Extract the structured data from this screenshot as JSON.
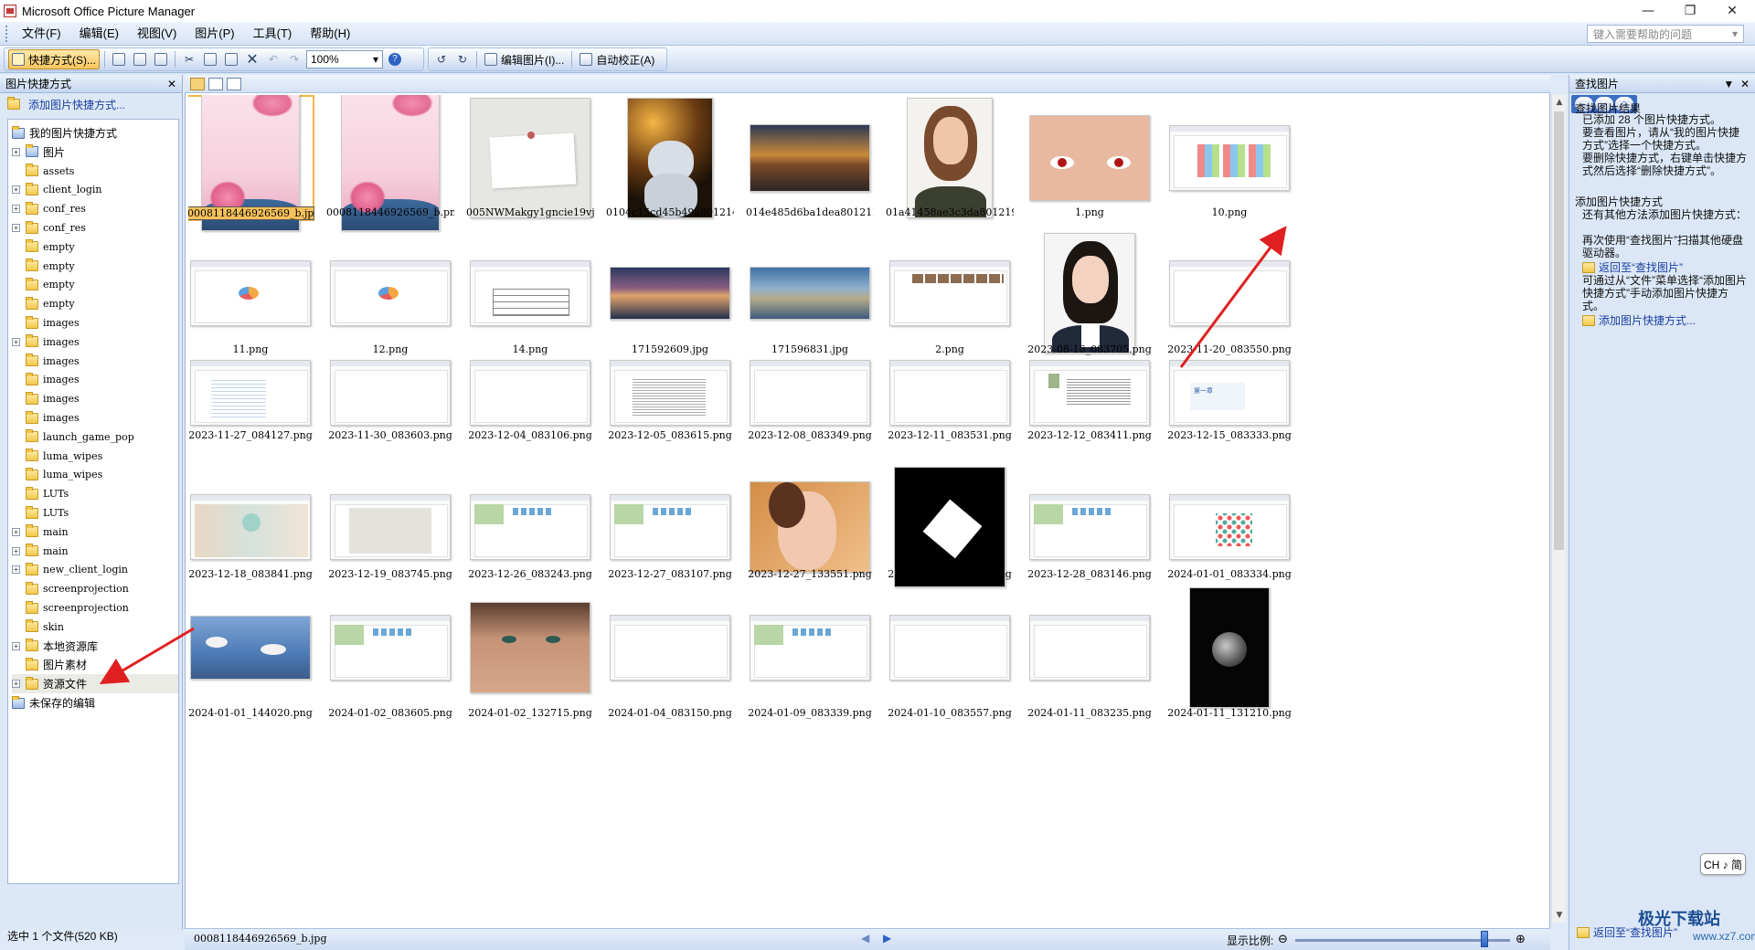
{
  "window": {
    "title": "Microsoft Office Picture Manager",
    "minimize": "—",
    "maximize": "❐",
    "close": "✕"
  },
  "menu": [
    "文件(F)",
    "编辑(E)",
    "视图(V)",
    "图片(P)",
    "工具(T)",
    "帮助(H)"
  ],
  "help_search_placeholder": "键入需要帮助的问题",
  "toolbar": {
    "shortcuts_label": "快捷方式(S)...",
    "zoom": "100%",
    "edit_picture_label": "编辑图片(I)...",
    "auto_correct_label": "自动校正(A)"
  },
  "left_pane": {
    "title": "图片快捷方式",
    "add_shortcut": "添加图片快捷方式...",
    "tree": [
      {
        "label": "我的图片快捷方式",
        "level": 0,
        "expander": "",
        "icon": "shortcut-root-icon"
      },
      {
        "label": "图片",
        "level": 1,
        "expander": "+",
        "icon": "picture-folder-icon"
      },
      {
        "label": "assets",
        "level": 1,
        "expander": "",
        "icon": "folder-icon",
        "mono": true
      },
      {
        "label": "client_login",
        "level": 1,
        "expander": "+",
        "icon": "folder-icon",
        "mono": true
      },
      {
        "label": "conf_res",
        "level": 1,
        "expander": "+",
        "icon": "folder-icon",
        "mono": true
      },
      {
        "label": "conf_res",
        "level": 1,
        "expander": "+",
        "icon": "folder-icon",
        "mono": true
      },
      {
        "label": "empty",
        "level": 1,
        "expander": "",
        "icon": "folder-icon",
        "mono": true
      },
      {
        "label": "empty",
        "level": 1,
        "expander": "",
        "icon": "folder-icon",
        "mono": true
      },
      {
        "label": "empty",
        "level": 1,
        "expander": "",
        "icon": "folder-icon",
        "mono": true
      },
      {
        "label": "empty",
        "level": 1,
        "expander": "",
        "icon": "folder-icon",
        "mono": true
      },
      {
        "label": "images",
        "level": 1,
        "expander": "",
        "icon": "folder-icon",
        "mono": true
      },
      {
        "label": "images",
        "level": 1,
        "expander": "+",
        "icon": "folder-icon",
        "mono": true
      },
      {
        "label": "images",
        "level": 1,
        "expander": "",
        "icon": "folder-icon",
        "mono": true
      },
      {
        "label": "images",
        "level": 1,
        "expander": "",
        "icon": "folder-icon",
        "mono": true
      },
      {
        "label": "images",
        "level": 1,
        "expander": "",
        "icon": "folder-icon",
        "mono": true
      },
      {
        "label": "images",
        "level": 1,
        "expander": "",
        "icon": "folder-icon",
        "mono": true
      },
      {
        "label": "launch_game_pop",
        "level": 1,
        "expander": "",
        "icon": "folder-icon",
        "mono": true
      },
      {
        "label": "luma_wipes",
        "level": 1,
        "expander": "",
        "icon": "folder-icon",
        "mono": true
      },
      {
        "label": "luma_wipes",
        "level": 1,
        "expander": "",
        "icon": "folder-icon",
        "mono": true
      },
      {
        "label": "LUTs",
        "level": 1,
        "expander": "",
        "icon": "folder-icon",
        "mono": true
      },
      {
        "label": "LUTs",
        "level": 1,
        "expander": "",
        "icon": "folder-icon",
        "mono": true
      },
      {
        "label": "main",
        "level": 1,
        "expander": "+",
        "icon": "folder-icon",
        "mono": true
      },
      {
        "label": "main",
        "level": 1,
        "expander": "+",
        "icon": "folder-icon",
        "mono": true
      },
      {
        "label": "new_client_login",
        "level": 1,
        "expander": "+",
        "icon": "folder-icon",
        "mono": true
      },
      {
        "label": "screenprojection",
        "level": 1,
        "expander": "",
        "icon": "folder-icon",
        "mono": true
      },
      {
        "label": "screenprojection",
        "level": 1,
        "expander": "",
        "icon": "folder-icon",
        "mono": true
      },
      {
        "label": "skin",
        "level": 1,
        "expander": "",
        "icon": "folder-icon",
        "mono": true
      },
      {
        "label": "本地资源库",
        "level": 1,
        "expander": "+",
        "icon": "folder-icon"
      },
      {
        "label": "图片素材",
        "level": 1,
        "expander": "",
        "icon": "folder-icon"
      },
      {
        "label": "资源文件",
        "level": 1,
        "expander": "+",
        "icon": "folder-icon",
        "selected": true
      },
      {
        "label": "未保存的编辑",
        "level": 0,
        "expander": "",
        "icon": "unsaved-edits-icon"
      }
    ],
    "status": "选中 1 个文件(520 KB)"
  },
  "grid": {
    "rows": [
      [
        {
          "name": "0008118446926569_b.jpg",
          "kind": "pink-flowers",
          "selected": true
        },
        {
          "name": "0008118446926569_b.png",
          "kind": "pink-flowers"
        },
        {
          "name": "005NWMakgy1gncie19vj0j30j...",
          "kind": "card"
        },
        {
          "name": "0104c15cd45b49a8012141681...",
          "kind": "cat"
        },
        {
          "name": "014e485d6ba1dea801211f9e3...",
          "kind": "sunset"
        },
        {
          "name": "01a41458ae3c3da801219c774...",
          "kind": "portrait-woman"
        },
        {
          "name": "1.png",
          "kind": "eyes"
        },
        {
          "name": "10.png",
          "kind": "screenshot-colorful"
        }
      ],
      [
        {
          "name": "11.png",
          "kind": "screenshot-pie"
        },
        {
          "name": "12.png",
          "kind": "screenshot-pie"
        },
        {
          "name": "14.png",
          "kind": "screenshot-table"
        },
        {
          "name": "171592609.jpg",
          "kind": "city-night"
        },
        {
          "name": "171596831.jpg",
          "kind": "city-day"
        },
        {
          "name": "2.png",
          "kind": "screenshot-app"
        },
        {
          "name": "2023-08-16_083705.png",
          "kind": "portrait-girl"
        },
        {
          "name": "2023-11-20_083550.png",
          "kind": "screenshot"
        }
      ],
      [
        {
          "name": "2023-11-27_084127.png",
          "kind": "screenshot-list"
        },
        {
          "name": "2023-11-30_083603.png",
          "kind": "screenshot"
        },
        {
          "name": "2023-12-04_083106.png",
          "kind": "screenshot"
        },
        {
          "name": "2023-12-05_083615.png",
          "kind": "screenshot-text"
        },
        {
          "name": "2023-12-08_083349.png",
          "kind": "screenshot"
        },
        {
          "name": "2023-12-11_083531.png",
          "kind": "screenshot"
        },
        {
          "name": "2023-12-12_083411.png",
          "kind": "screenshot-doc"
        },
        {
          "name": "2023-12-15_083333.png",
          "kind": "screenshot-slide",
          "slide_text": "第一章"
        }
      ],
      [
        {
          "name": "2023-12-18_083841.png",
          "kind": "screenshot-blur"
        },
        {
          "name": "2023-12-19_083745.png",
          "kind": "screenshot-gray"
        },
        {
          "name": "2023-12-26_083243.png",
          "kind": "screenshot-sheet"
        },
        {
          "name": "2023-12-27_083107.png",
          "kind": "screenshot-sheet"
        },
        {
          "name": "2023-12-27_133551.png",
          "kind": "smiling-woman"
        },
        {
          "name": "2023-12-27_134728.png",
          "kind": "black-diamond"
        },
        {
          "name": "2023-12-28_083146.png",
          "kind": "screenshot-sheet"
        },
        {
          "name": "2024-01-01_083334.png",
          "kind": "screenshot-dots"
        }
      ],
      [
        {
          "name": "2024-01-01_144020.png",
          "kind": "seagulls"
        },
        {
          "name": "2024-01-02_083605.png",
          "kind": "screenshot-sheet"
        },
        {
          "name": "2024-01-02_132715.png",
          "kind": "face-closeup"
        },
        {
          "name": "2024-01-04_083150.png",
          "kind": "screenshot"
        },
        {
          "name": "2024-01-09_083339.png",
          "kind": "screenshot-sheet"
        },
        {
          "name": "2024-01-10_083557.png",
          "kind": "screenshot"
        },
        {
          "name": "2024-01-11_083235.png",
          "kind": "screenshot"
        },
        {
          "name": "2024-01-11_131210.png",
          "kind": "moon-dark"
        }
      ]
    ]
  },
  "status_main": {
    "current_file": "0008118446926569_b.jpg",
    "zoom_label": "显示比例:"
  },
  "right_pane": {
    "title": "查找图片",
    "nav": [
      "←",
      "→",
      "⌂"
    ],
    "results_heading": "查找图片结果",
    "results_text_1": "已添加 28 个图片快捷方式。",
    "results_text_2": "要查看图片，请从“我的图片快捷方式”选择一个快捷方式。",
    "results_text_3": "要删除快捷方式，右键单击快捷方式然后选择“删除快捷方式”。",
    "add_heading": "添加图片快捷方式",
    "add_text_1": "还有其他方法添加图片快捷方式：",
    "add_text_2": "再次使用“查找图片”扫描其他硬盘驱动器。",
    "link_back": "返回至“查找图片”",
    "add_text_3": "可通过从“文件”菜单选择“添加图片快捷方式”手动添加图片快捷方式。",
    "link_add": "添加图片快捷方式...",
    "bottom_link": "返回至“查找图片”"
  },
  "ime": "CH ♪ 简",
  "watermark": {
    "main": "极光下载站",
    "sub": "www.xz7.com"
  },
  "colors": {
    "accent": "#3c6cc4",
    "selection": "#f6c15a",
    "arrow": "#e02020"
  }
}
